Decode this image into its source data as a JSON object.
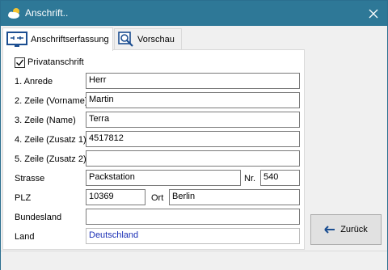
{
  "window": {
    "title": "Anschrift..",
    "accent": "#2e7897"
  },
  "tabs": [
    {
      "label": "Anschriftserfassung",
      "icon": "address-card-icon",
      "active": true
    },
    {
      "label": "Vorschau",
      "icon": "magnifier-icon",
      "active": false
    }
  ],
  "form": {
    "privat_label": "Privatanschrift",
    "privat_checked": true,
    "anrede_label": "1. Anrede",
    "anrede_value": "Herr",
    "zeile2_label": "2. Zeile (Vorname)",
    "zeile2_value": "Martin",
    "zeile3_label": "3. Zeile (Name)",
    "zeile3_value": "Terra",
    "zeile4_label": "4. Zeile (Zusatz 1)",
    "zeile4_value": "4517812",
    "zeile5_label": "5. Zeile (Zusatz 2)",
    "zeile5_value": "",
    "strasse_label": "Strasse",
    "strasse_value": "Packstation",
    "nr_label": "Nr.",
    "nr_value": "540",
    "plz_label": "PLZ",
    "plz_value": "10369",
    "ort_label": "Ort",
    "ort_value": "Berlin",
    "bundesland_label": "Bundesland",
    "bundesland_value": "",
    "land_label": "Land",
    "land_value": "Deutschland",
    "link_color": "#1a2fb5"
  },
  "buttons": {
    "back_label": "Zurück",
    "back_icon": "arrow-left-icon"
  }
}
